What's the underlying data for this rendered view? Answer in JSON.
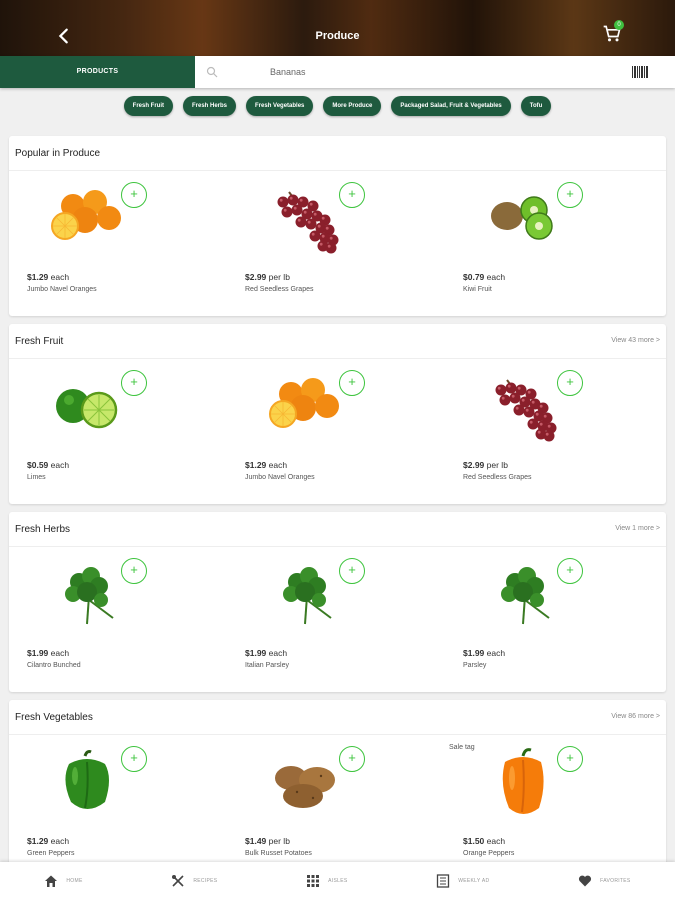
{
  "header": {
    "title": "Produce",
    "back_icon": "back-chevron-icon",
    "cart_icon": "cart-icon",
    "cart_count": "0"
  },
  "searchbar": {
    "products_tab": "PRODUCTS",
    "search_value": "Bananas",
    "search_icon": "search-icon",
    "barcode_icon": "barcode-icon"
  },
  "chips": [
    "Fresh Fruit",
    "Fresh Herbs",
    "Fresh Vegetables",
    "More Produce",
    "Packaged Salad, Fruit & Vegetables",
    "Tofu"
  ],
  "colors": {
    "brand_green": "#1e5a3e",
    "add_green": "#3ec43e"
  },
  "sections": [
    {
      "title": "Popular in Produce",
      "view_more": "",
      "products": [
        {
          "price": "$1.29",
          "unit": "each",
          "name": "Jumbo Navel Oranges",
          "image": "oranges"
        },
        {
          "price": "$2.99",
          "unit": "per lb",
          "name": "Red Seedless Grapes",
          "image": "grapes"
        },
        {
          "price": "$0.79",
          "unit": "each",
          "name": "Kiwi Fruit",
          "image": "kiwi"
        }
      ]
    },
    {
      "title": "Fresh Fruit",
      "view_more": "View 43 more >",
      "products": [
        {
          "price": "$0.59",
          "unit": "each",
          "name": "Limes",
          "image": "limes"
        },
        {
          "price": "$1.29",
          "unit": "each",
          "name": "Jumbo Navel Oranges",
          "image": "oranges"
        },
        {
          "price": "$2.99",
          "unit": "per lb",
          "name": "Red Seedless Grapes",
          "image": "grapes"
        }
      ]
    },
    {
      "title": "Fresh Herbs",
      "view_more": "View 1 more >",
      "products": [
        {
          "price": "$1.99",
          "unit": "each",
          "name": "Cilantro Bunched",
          "image": "herb"
        },
        {
          "price": "$1.99",
          "unit": "each",
          "name": "Italian Parsley",
          "image": "herb"
        },
        {
          "price": "$1.99",
          "unit": "each",
          "name": "Parsley",
          "image": "herb"
        }
      ]
    },
    {
      "title": "Fresh Vegetables",
      "view_more": "View 86 more >",
      "products": [
        {
          "price": "$1.29",
          "unit": "each",
          "name": "Green Peppers",
          "image": "green-pepper"
        },
        {
          "price": "$1.49",
          "unit": "per lb",
          "name": "Bulk Russet Potatoes",
          "image": "potatoes"
        },
        {
          "price": "$1.50",
          "unit": "each",
          "name": "Orange Peppers",
          "image": "orange-pepper",
          "sale_tag": "Sale tag"
        }
      ]
    }
  ],
  "bottom_nav": [
    {
      "label": "HOME",
      "icon": "home-icon"
    },
    {
      "label": "RECIPES",
      "icon": "recipes-icon"
    },
    {
      "label": "AISLES",
      "icon": "aisles-icon"
    },
    {
      "label": "WEEKLY AD",
      "icon": "weekly-ad-icon"
    },
    {
      "label": "FAVORITES",
      "icon": "heart-icon"
    }
  ]
}
